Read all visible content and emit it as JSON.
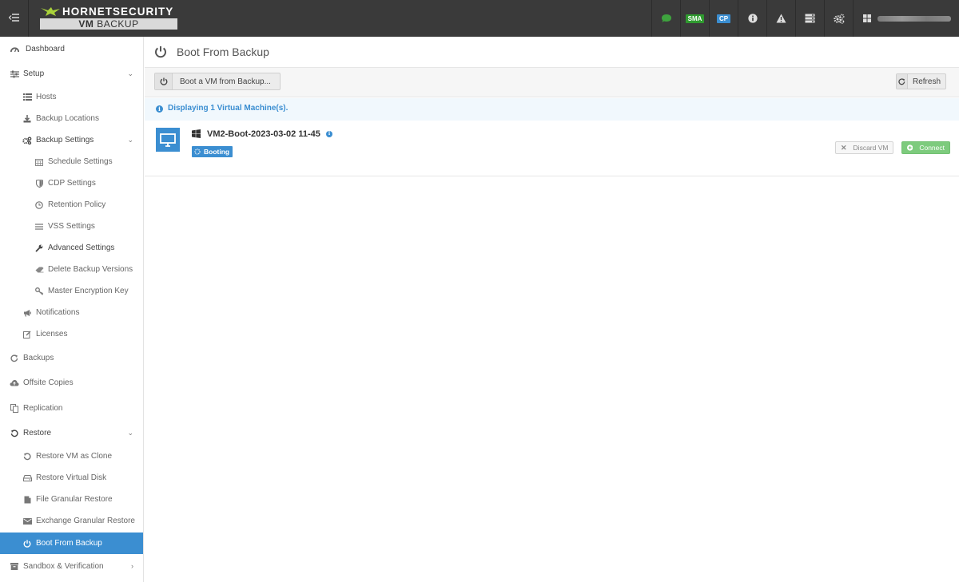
{
  "app": {
    "brand_name": "HORNETSECURITY",
    "product_prefix": "VM",
    "product_suffix": "BACKUP"
  },
  "header": {
    "badges": {
      "sma": "SMA",
      "cp": "CP"
    },
    "colors": {
      "bar": "#3a3a3a",
      "chat": "#3ea33e",
      "sma": "#2f9a2f",
      "cp": "#3b8ed1"
    }
  },
  "sidebar": {
    "items": [
      {
        "label": "Dashboard",
        "icon": "dashboard-icon"
      },
      {
        "label": "Setup",
        "icon": "sliders-icon"
      },
      {
        "label": "Hosts",
        "icon": "list-icon"
      },
      {
        "label": "Backup Locations",
        "icon": "download-icon"
      },
      {
        "label": "Backup Settings",
        "icon": "gears-icon"
      },
      {
        "label": "Schedule Settings",
        "icon": "calendar-icon"
      },
      {
        "label": "CDP Settings",
        "icon": "shield-icon"
      },
      {
        "label": "Retention Policy",
        "icon": "clock-icon"
      },
      {
        "label": "VSS Settings",
        "icon": "lines-icon"
      },
      {
        "label": "Advanced Settings",
        "icon": "wrench-icon"
      },
      {
        "label": "Delete Backup Versions",
        "icon": "eraser-icon"
      },
      {
        "label": "Master Encryption Key",
        "icon": "key-icon"
      },
      {
        "label": "Notifications",
        "icon": "bullhorn-icon"
      },
      {
        "label": "Licenses",
        "icon": "edit-icon"
      },
      {
        "label": "Backups",
        "icon": "refresh-icon"
      },
      {
        "label": "Offsite Copies",
        "icon": "cloud-upload-icon"
      },
      {
        "label": "Replication",
        "icon": "copy-icon"
      },
      {
        "label": "Restore",
        "icon": "undo-icon"
      },
      {
        "label": "Restore VM as Clone",
        "icon": "undo-icon"
      },
      {
        "label": "Restore Virtual Disk",
        "icon": "hdd-icon"
      },
      {
        "label": "File Granular Restore",
        "icon": "file-icon"
      },
      {
        "label": "Exchange Granular Restore",
        "icon": "envelope-icon"
      },
      {
        "label": "Boot From Backup",
        "icon": "power-icon"
      },
      {
        "label": "Sandbox & Verification",
        "icon": "box-icon"
      }
    ]
  },
  "page": {
    "title": "Boot From Backup",
    "boot_button": "Boot a VM from Backup...",
    "refresh_button": "Refresh",
    "info_text": "Displaying 1 Virtual Machine(s).",
    "vm": {
      "name": "VM2-Boot-2023-03-02 11-45",
      "status": "Booting",
      "discard_label": "Discard VM",
      "connect_label": "Connect"
    }
  },
  "colors": {
    "accent": "#3b8ed1",
    "connect": "#7dcb7d",
    "active_nav": "#3b8ed1"
  }
}
